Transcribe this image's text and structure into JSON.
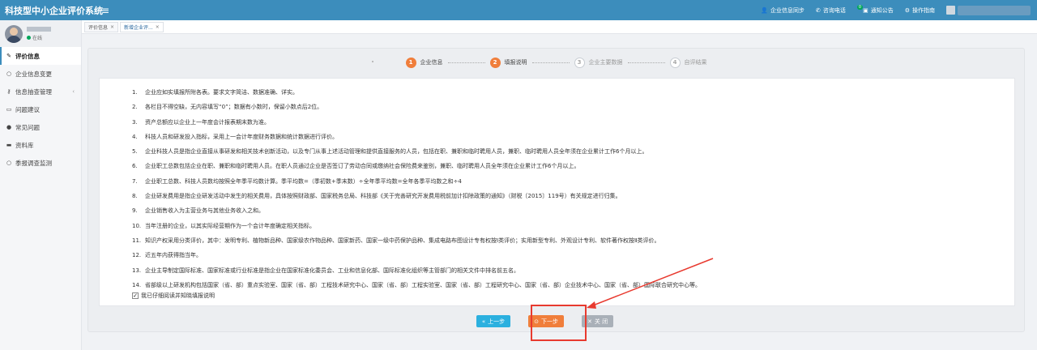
{
  "header": {
    "title": "科技型中小企业评价系统",
    "menu_icon": "bars-icon",
    "actions": [
      {
        "label": "企业信息同步",
        "icon": "user-icon"
      },
      {
        "label": "咨询电话",
        "icon": "phone-icon"
      },
      {
        "label": "通知公告",
        "icon": "bell-icon",
        "badge": "0"
      },
      {
        "label": "操作指南",
        "icon": "gear-icon"
      }
    ]
  },
  "sidebar": {
    "status": "在线",
    "items": [
      {
        "label": "评价信息",
        "icon": "edit-icon"
      },
      {
        "label": "企业信息变更",
        "icon": "circle-icon"
      },
      {
        "label": "信息抽查管理",
        "icon": "key-icon"
      },
      {
        "label": "问题建议",
        "icon": "comment-icon"
      },
      {
        "label": "常见问题",
        "icon": "question-icon"
      },
      {
        "label": "资料库",
        "icon": "folder-icon"
      },
      {
        "label": "季报调查监测",
        "icon": "circle-icon"
      }
    ]
  },
  "tabs": [
    {
      "label": "评价信息"
    },
    {
      "label": "新增企业评..."
    }
  ],
  "steps": [
    {
      "num": "1",
      "label": "企业信息",
      "state": "done"
    },
    {
      "num": "2",
      "label": "填报说明",
      "state": "done"
    },
    {
      "num": "3",
      "label": "企业主要数据",
      "state": "todo"
    },
    {
      "num": "4",
      "label": "自评结果",
      "state": "todo"
    }
  ],
  "rules": [
    {
      "n": "1.",
      "text": "企业应如实填报所附各表。要求文字简洁、数据准确、详实。"
    },
    {
      "n": "2.",
      "text": "各栏目不得空缺，无内容填写“0”；数据有小数时，保留小数点后2位。"
    },
    {
      "n": "3.",
      "text": "资产总额应以企业上一年度会计报表期末数为准。"
    },
    {
      "n": "4.",
      "text": "科技人员和研发投入指标，采用上一会计年度财务数据和统计数据进行评价。"
    },
    {
      "n": "5.",
      "text": "企业科技人员是指企业直接从事研发和相关技术创新活动，以及专门从事上述活动管理和提供直接服务的人员，包括在职、兼职和临时聘用人员，兼职、临时聘用人员全年须在企业累计工作6个月以上。"
    },
    {
      "n": "6.",
      "text": "企业职工总数包括企业在职、兼职和临时聘用人员。在职人员通过企业是否签订了劳动合同或缴纳社会保险费来鉴别，兼职、临时聘用人员全年须在企业累计工作6个月以上。"
    },
    {
      "n": "7.",
      "text": "企业职工总数、科技人员数均按照全年季平均数计算。季平均数=（季初数+季末数）÷全年季平均数=全年各季平均数之和÷4"
    },
    {
      "n": "8.",
      "text": "企业研发费用是指企业研发活动中发生的相关费用，具体按照财政部、国家税务总局、科技部《关于完善研究开发费用税前加计扣除政策的通知》（财税〔2015〕119号）有关规定进行归集。"
    },
    {
      "n": "9.",
      "text": "企业销售收入为主营业务与其他业务收入之和。"
    },
    {
      "n": "10.",
      "text": "当年注册的企业，以其实际经营期作为一个会计年度确定相关指标。"
    },
    {
      "n": "11.",
      "text": "知识产权采用分类评价，其中：发明专利、植物新品种、国家级农作物品种、国家新药、国家一级中药保护品种、集成电路布图设计专有权按Ⅰ类评价；实用新型专利、外观设计专利、软件著作权按Ⅱ类评价。"
    },
    {
      "n": "12.",
      "text": "近五年内获得指当年。"
    },
    {
      "n": "13.",
      "text": "企业主导制定国际标准、国家标准或行业标准是指企业在国家标准化委员会、工业和信息化部、国际标准化组织等主管部门的相关文件中排名前五名。"
    },
    {
      "n": "14.",
      "text": "省部级以上研发机构包括国家（省、部）重点实验室、国家（省、部）工程技术研究中心、国家（省、部）工程实验室、国家（省、部）工程研究中心、国家（省、部）企业技术中心、国家（省、部）国际联合研究中心等。"
    }
  ],
  "agree": {
    "label": "我已仔细阅读并知晓填报说明",
    "checked": "✓"
  },
  "buttons": {
    "prev": "上一步",
    "next": "下一步",
    "close": "关 闭"
  },
  "colors": {
    "header": "#3c8dbc",
    "accent": "#f07e3b",
    "prev": "#2bb0df",
    "highlight": "#e83a2f"
  }
}
